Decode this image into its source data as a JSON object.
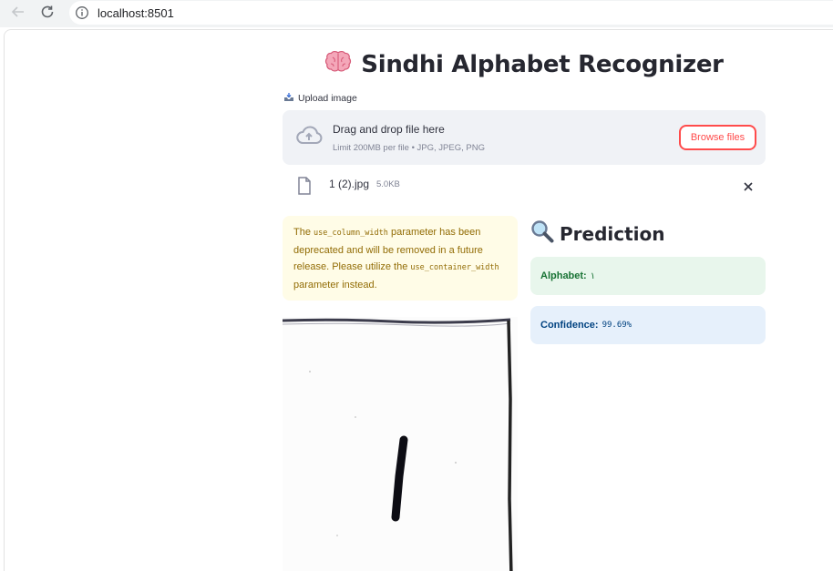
{
  "browser": {
    "url": "localhost:8501"
  },
  "app": {
    "title_icon": "brain-emoji",
    "title": "Sindhi Alphabet Recognizer"
  },
  "uploader": {
    "label": "Upload image",
    "dropzone_title": "Drag and drop file here",
    "dropzone_limit": "Limit 200MB per file • JPG, JPEG, PNG",
    "browse_label": "Browse files",
    "file_name": "1 (2).jpg",
    "file_size": "5.0KB"
  },
  "warning": {
    "text_1": "The ",
    "code_1": "use_column_width",
    "text_2": " parameter has been deprecated and will be removed in a future release. Please utilize the ",
    "code_2": "use_container_width",
    "text_3": " parameter instead."
  },
  "prediction": {
    "header_icon": "magnifier-emoji",
    "header": "Prediction",
    "alphabet_label": "Alphabet:",
    "alphabet_value": "١",
    "confidence_label": "Confidence:",
    "confidence_value": "99.69%"
  },
  "colors": {
    "accent": "#ff4b4b",
    "success_bg": "#e8f6ec",
    "info_bg": "#e6f0fb",
    "warning_bg": "#fffce7"
  }
}
